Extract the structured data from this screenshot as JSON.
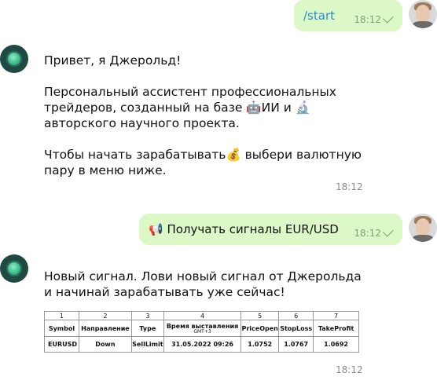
{
  "messages": {
    "start": {
      "text": "/start",
      "time": "18:12"
    },
    "greeting": {
      "line1": "Привет, я Джерольд!",
      "p2_1": "Персональный ассистент профессиональных",
      "p2_2": "трейдеров, созданный на базе 🤖ИИ и 🔬",
      "p2_3": "авторского научного проекта.",
      "p3_1": "Чтобы начать зарабатывать💰 выбери валютную",
      "p3_2": "пару в меню ниже.",
      "time": "18:12"
    },
    "request": {
      "text": "📢 Получать сигналы EUR/USD",
      "time": "18:12"
    },
    "signal": {
      "line1": "Новый сигнал. Лови новый сигнал от Джерольда",
      "line2": "и начинай зарабатывать уже сейчас!",
      "time": "18:12",
      "table": {
        "numbers": [
          "1",
          "2",
          "3",
          "4",
          "5",
          "6",
          "7"
        ],
        "headers": [
          "Symbol",
          "Направление",
          "Type",
          "Время выставления",
          "PriceOpen",
          "StopLoss",
          "TakeProfit"
        ],
        "header_sub": "GMT+3",
        "row": [
          "EURUSD",
          "Down",
          "SellLimit",
          "31.05.2022 09:26",
          "1.0752",
          "1.0767",
          "1.0692"
        ]
      }
    }
  }
}
